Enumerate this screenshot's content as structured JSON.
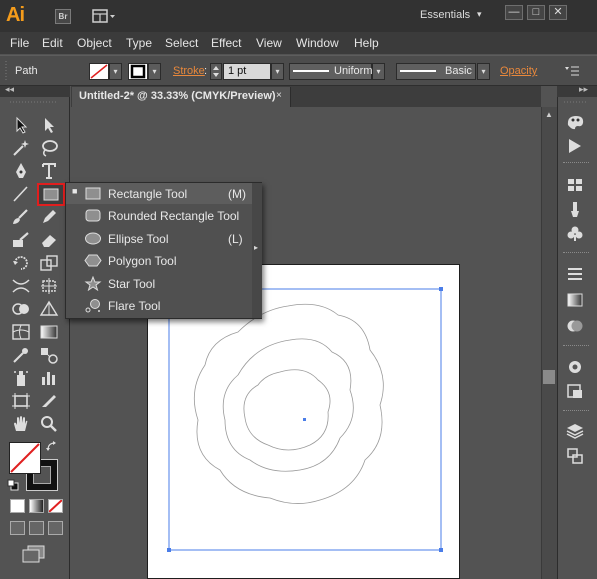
{
  "app": {
    "logo": "Ai",
    "bridge_label": "Br",
    "workspace": "Essentials",
    "window_buttons": [
      "—",
      "□",
      "✕"
    ]
  },
  "menu": [
    "File",
    "Edit",
    "Object",
    "Type",
    "Select",
    "Effect",
    "View",
    "Window",
    "Help"
  ],
  "control_bar": {
    "selection_label": "Path",
    "stroke_label": "Stroke",
    "stroke_weight": "1 pt",
    "profile": "Uniform",
    "brush": "Basic",
    "opacity_label": "Opacity"
  },
  "document": {
    "tab_title": "Untitled-2* @ 33.33% (CMYK/Preview)",
    "close": "×"
  },
  "flyout": {
    "items": [
      {
        "label": "Rectangle Tool",
        "key": "(M)",
        "icon": "rectangle-icon",
        "selected": true
      },
      {
        "label": "Rounded Rectangle Tool",
        "key": "",
        "icon": "rounded-rectangle-icon",
        "selected": false
      },
      {
        "label": "Ellipse Tool",
        "key": "(L)",
        "icon": "ellipse-icon",
        "selected": false
      },
      {
        "label": "Polygon Tool",
        "key": "",
        "icon": "polygon-icon",
        "selected": false
      },
      {
        "label": "Star Tool",
        "key": "",
        "icon": "star-icon",
        "selected": false
      },
      {
        "label": "Flare Tool",
        "key": "",
        "icon": "flare-icon",
        "selected": false
      }
    ]
  },
  "colors": {
    "accent": "#f59c1b",
    "highlight_box": "#e21e1e",
    "selection": "#4a7de8",
    "link": "#e8883c"
  }
}
